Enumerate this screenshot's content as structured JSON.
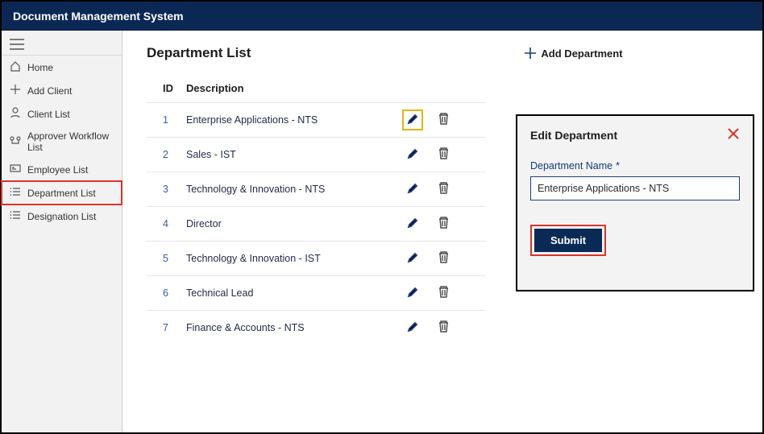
{
  "app": {
    "title": "Document Management System"
  },
  "sidebar": {
    "items": [
      {
        "label": "Home",
        "icon": "home-icon",
        "highlight": false
      },
      {
        "label": "Add Client",
        "icon": "plus-icon",
        "highlight": false
      },
      {
        "label": "Client List",
        "icon": "user-icon",
        "highlight": false
      },
      {
        "label": "Approver Workflow List",
        "icon": "workflow-icon",
        "highlight": false
      },
      {
        "label": "Employee List",
        "icon": "card-icon",
        "highlight": false
      },
      {
        "label": "Department List",
        "icon": "list-icon",
        "highlight": true
      },
      {
        "label": "Designation List",
        "icon": "list-icon",
        "highlight": false
      }
    ]
  },
  "header": {
    "page_title": "Department List",
    "add_label": "Add Department"
  },
  "table": {
    "columns": {
      "id": "ID",
      "description": "Description"
    },
    "rows": [
      {
        "id": "1",
        "description": "Enterprise Applications - NTS",
        "edit_highlight": true
      },
      {
        "id": "2",
        "description": "Sales - IST"
      },
      {
        "id": "3",
        "description": "Technology & Innovation - NTS"
      },
      {
        "id": "4",
        "description": "Director"
      },
      {
        "id": "5",
        "description": "Technology & Innovation  - IST"
      },
      {
        "id": "6",
        "description": "Technical Lead"
      },
      {
        "id": "7",
        "description": "Finance & Accounts - NTS"
      }
    ]
  },
  "dialog": {
    "title": "Edit Department",
    "field_label": "Department Name",
    "required_mark": "*",
    "field_value": "Enterprise Applications - NTS",
    "submit_label": "Submit"
  }
}
